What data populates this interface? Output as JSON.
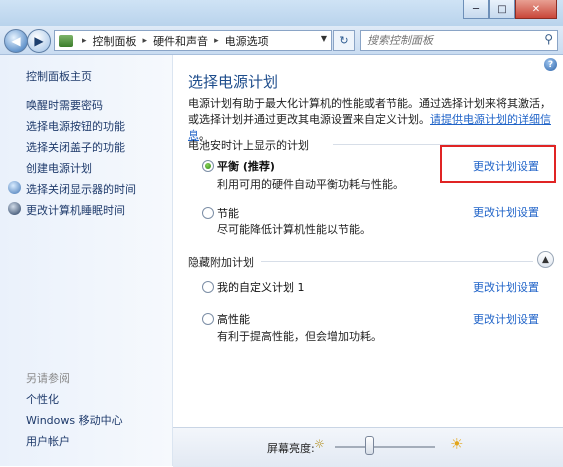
{
  "window": {
    "minimize": "─",
    "maximize": "□",
    "close": "✕"
  },
  "nav": {
    "back": "◀",
    "forward": "▶",
    "address": {
      "part1": "控制面板",
      "part2": "硬件和声音",
      "part3": "电源选项",
      "separator": "▸"
    },
    "refresh": "↻",
    "search_placeholder": "搜索控制面板"
  },
  "sidebar": {
    "home": "控制面板主页",
    "links": [
      "唤醒时需要密码",
      "选择电源按钮的功能",
      "选择关闭盖子的功能",
      "创建电源计划",
      "选择关闭显示器的时间",
      "更改计算机睡眠时间"
    ],
    "see_also": "另请参阅",
    "see_also_links": [
      "个性化",
      "Windows 移动中心",
      "用户帐户"
    ]
  },
  "main": {
    "help": "?",
    "title": "选择电源计划",
    "description_text": "电源计划有助于最大化计算机的性能或者节能。通过选择计划来将其激活，或选择计划并通过更改其电源设置来自定义计划。",
    "description_link": "请提供电源计划的详细信息",
    "description_end": "。",
    "group1": "电池安时计上显示的计划",
    "group2": "隐藏附加计划",
    "collapse": "▲",
    "plans": [
      {
        "name": "平衡 (推荐)",
        "desc": "利用可用的硬件自动平衡功耗与性能。",
        "selected": true,
        "link": "更改计划设置"
      },
      {
        "name": "节能",
        "desc": "尽可能降低计算机性能以节能。",
        "selected": false,
        "link": "更改计划设置"
      },
      {
        "name": "我的自定义计划 1",
        "desc": "",
        "selected": false,
        "link": "更改计划设置"
      },
      {
        "name": "高性能",
        "desc": "有利于提高性能，但会增加功耗。",
        "selected": false,
        "link": "更改计划设置"
      }
    ]
  },
  "bottom": {
    "brightness_label": "屏幕亮度:",
    "brightness_dim_icon": "☼",
    "brightness_bright_icon": "☀",
    "brightness_level": 0.3
  },
  "colors": {
    "link": "#1f63c8",
    "title": "#1e4d8c",
    "highlight": "#e02424"
  }
}
